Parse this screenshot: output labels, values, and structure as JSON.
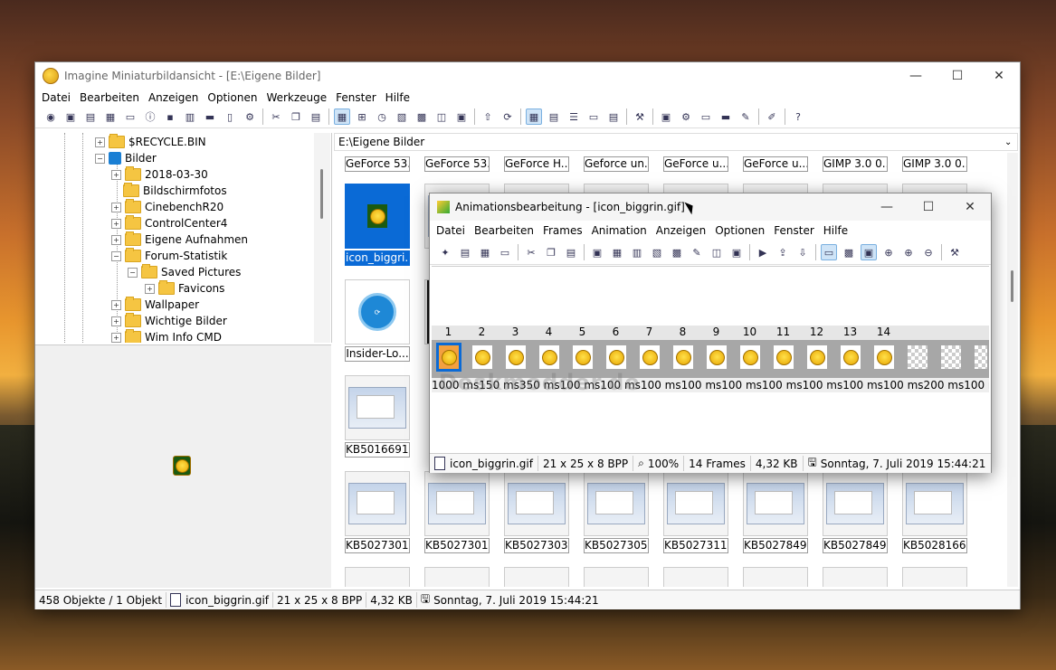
{
  "main": {
    "title": "Imagine Miniaturbildansicht - [E:\\Eigene Bilder]",
    "menu": [
      "Datei",
      "Bearbeiten",
      "Anzeigen",
      "Optionen",
      "Werkzeuge",
      "Fenster",
      "Hilfe"
    ],
    "window_controls": {
      "minimize": "—",
      "maximize": "☐",
      "close": "✕"
    },
    "path": "E:\\Eigene Bilder",
    "tree": [
      {
        "label": "$RECYCLE.BIN",
        "expander": "+"
      },
      {
        "label": "Bilder",
        "expander": "−"
      },
      {
        "label": "2018-03-30",
        "expander": "+"
      },
      {
        "label": "Bildschirmfotos",
        "expander": ""
      },
      {
        "label": "CinebenchR20",
        "expander": "+"
      },
      {
        "label": "ControlCenter4",
        "expander": "+"
      },
      {
        "label": "Eigene Aufnahmen",
        "expander": "+"
      },
      {
        "label": "Forum-Statistik",
        "expander": "−"
      },
      {
        "label": "Saved Pictures",
        "expander": "−"
      },
      {
        "label": "Favicons",
        "expander": "+"
      },
      {
        "label": "Wallpaper",
        "expander": "+"
      },
      {
        "label": "Wichtige Bilder",
        "expander": "+"
      },
      {
        "label": "Wim Info CMD",
        "expander": "+"
      }
    ],
    "thumbnails": {
      "row1": [
        "GeForce 53...",
        "GeForce 53...",
        "GeForce H...",
        "Geforce un...",
        "GeForce u...",
        "GeForce u...",
        "GIMP 3.0 0...",
        "GIMP 3.0 0..."
      ],
      "selected": "icon_biggri...",
      "insider": "Insider-Lo...",
      "kb1": "KB5016691 ...",
      "row5": [
        "KB5027301 ...",
        "KB5027301....",
        "KB5027303 ...",
        "KB5027305 ...",
        "KB5027311 ...",
        "KB5027849 ...",
        "KB5027849 ...",
        "KB5028166 ..."
      ]
    },
    "status": {
      "objects": "458 Objekte / 1 Objekt",
      "file": "icon_biggrin.gif",
      "dims": "21 x 25 x 8 BPP",
      "size": "4,32 KB",
      "date": "Sonntag, 7. Juli 2019 15:44:21"
    }
  },
  "anim": {
    "title": "Animationsbearbeitung - [icon_biggrin.gif]",
    "menu": [
      "Datei",
      "Bearbeiten",
      "Frames",
      "Animation",
      "Anzeigen",
      "Optionen",
      "Fenster",
      "Hilfe"
    ],
    "window_controls": {
      "minimize": "—",
      "maximize": "☐",
      "close": "✕"
    },
    "frame_numbers": [
      "1",
      "2",
      "3",
      "4",
      "5",
      "6",
      "7",
      "8",
      "9",
      "10",
      "11",
      "12",
      "13",
      "14"
    ],
    "delays": "1000 ms150 ms350 ms100 ms100 ms100 ms100 ms100 ms100 ms100 ms100 ms100 ms200 ms100 ms",
    "watermark": "Deskmodder.de",
    "status": {
      "file": "icon_biggrin.gif",
      "dims": "21 x 25 x 8 BPP",
      "zoom": "100%",
      "frames": "14 Frames",
      "size": "4,32 KB",
      "date": "Sonntag, 7. Juli 2019 15:44:21"
    }
  }
}
